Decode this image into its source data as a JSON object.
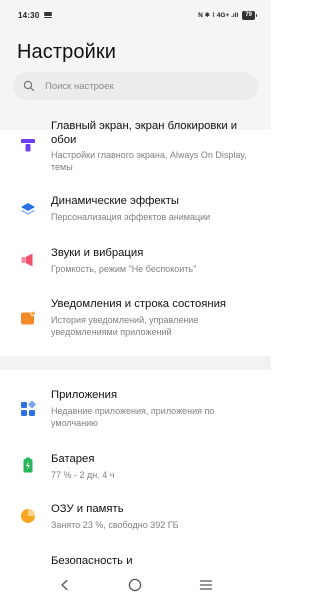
{
  "status_bar": {
    "time": "14:30",
    "indicators": "N ✱ ⌇ 4G+ .ıll",
    "battery": "79"
  },
  "page": {
    "title": "Настройки"
  },
  "search": {
    "placeholder": "Поиск настроек"
  },
  "items": [
    {
      "title": "Главный экран, экран блокировки и обои",
      "subtitle": "Настройки главного экрана, Always On Display, темы",
      "icon": "home-screen-icon",
      "color": "#6c3ff2"
    },
    {
      "title": "Динамические эффекты",
      "subtitle": "Персонализация эффектов анимации",
      "icon": "layers-icon",
      "color": "#2f6fe6"
    },
    {
      "title": "Звуки и вибрация",
      "subtitle": "Громкость, режим \"Не беспокоить\"",
      "icon": "speaker-icon",
      "color": "#f0506e"
    },
    {
      "title": "Уведомления и строка состояния",
      "subtitle": "История уведомлений, управление уведомлениями приложений",
      "icon": "notification-icon",
      "color": "#f58a2a"
    },
    {
      "title": "Приложения",
      "subtitle": "Недавние приложения, приложения по умолчанию",
      "icon": "apps-icon",
      "color": "#2f6fe6"
    },
    {
      "title": "Батарея",
      "subtitle": "77 % - 2 дн. 4 ч",
      "icon": "battery-icon",
      "color": "#27b55a"
    },
    {
      "title": "ОЗУ и память",
      "subtitle": "Занято 23 %, свободно 392 ГБ",
      "icon": "storage-pie-icon",
      "color": "#f5a623"
    },
    {
      "title": "Безопасность и",
      "subtitle": "",
      "icon": "security-icon",
      "color": "#2f6fe6"
    }
  ],
  "nav": {
    "back": "back-icon",
    "home": "home-icon",
    "recents": "menu-icon"
  }
}
